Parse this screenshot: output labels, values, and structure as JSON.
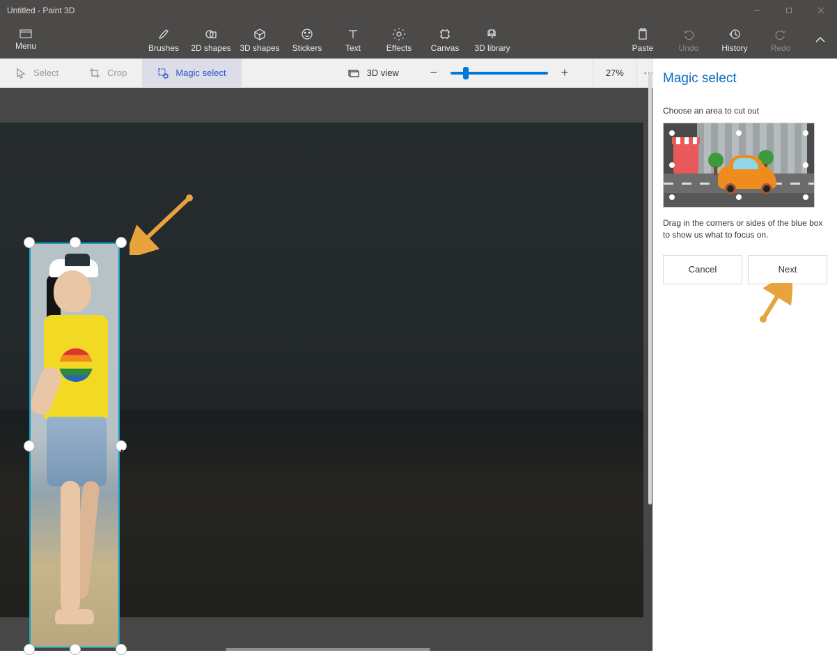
{
  "titlebar": {
    "title": "Untitled - Paint 3D"
  },
  "ribbon": {
    "menu": "Menu",
    "items": [
      {
        "label": "Brushes"
      },
      {
        "label": "2D shapes"
      },
      {
        "label": "3D shapes"
      },
      {
        "label": "Stickers"
      },
      {
        "label": "Text"
      },
      {
        "label": "Effects"
      },
      {
        "label": "Canvas"
      },
      {
        "label": "3D library"
      }
    ],
    "right": {
      "paste": "Paste",
      "undo": "Undo",
      "history": "History",
      "redo": "Redo"
    }
  },
  "subbar": {
    "select": "Select",
    "crop": "Crop",
    "magic_select": "Magic select",
    "view3d": "3D view",
    "zoom_pct": "27%"
  },
  "panel": {
    "title": "Magic select",
    "hint": "Choose an area to cut out",
    "description": "Drag in the corners or sides of the blue box to show us what to focus on.",
    "cancel": "Cancel",
    "next": "Next"
  }
}
